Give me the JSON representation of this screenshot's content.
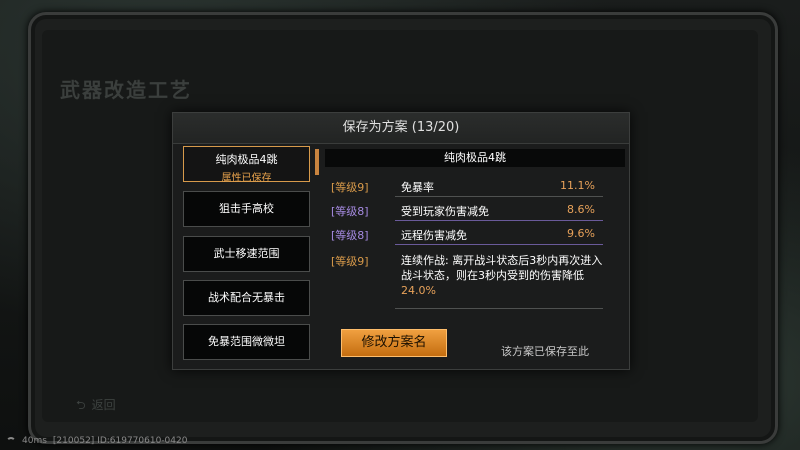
{
  "background": {
    "title": "武器改造工艺",
    "back_label": "返回"
  },
  "status_bar": {
    "ping": "40ms",
    "info": "[210052] ID:619770610-0420"
  },
  "dialog": {
    "title": "保存为方案 (13/20)",
    "plans": [
      {
        "name": "纯肉极品4跳",
        "status": "属性已保存",
        "active": true
      },
      {
        "name": "狙击手高校"
      },
      {
        "name": "武士移速范围"
      },
      {
        "name": "战术配合无暴击"
      },
      {
        "name": "免暴范围微微坦"
      }
    ],
    "detail": {
      "title": "纯肉极品4跳",
      "attributes": [
        {
          "level": "[等级9]",
          "name": "免暴率",
          "value": "11.1%"
        },
        {
          "level": "[等级8]",
          "name": "受到玩家伤害减免",
          "value": "8.6%"
        },
        {
          "level": "[等级8]",
          "name": "远程伤害减免",
          "value": "9.6%"
        },
        {
          "level": "[等级9]",
          "desc": "连续作战: 离开战斗状态后3秒内再次进入战斗状态，则在3秒内受到的伤害降低",
          "desc_value": "24.0%"
        }
      ]
    },
    "rename_button": "修改方案名",
    "saved_note": "该方案已保存至此"
  },
  "colors": {
    "accent": "#e8a25a",
    "button": "#e0902a",
    "level_gold": "#d89a4a",
    "level_purple": "#a58ae0"
  }
}
